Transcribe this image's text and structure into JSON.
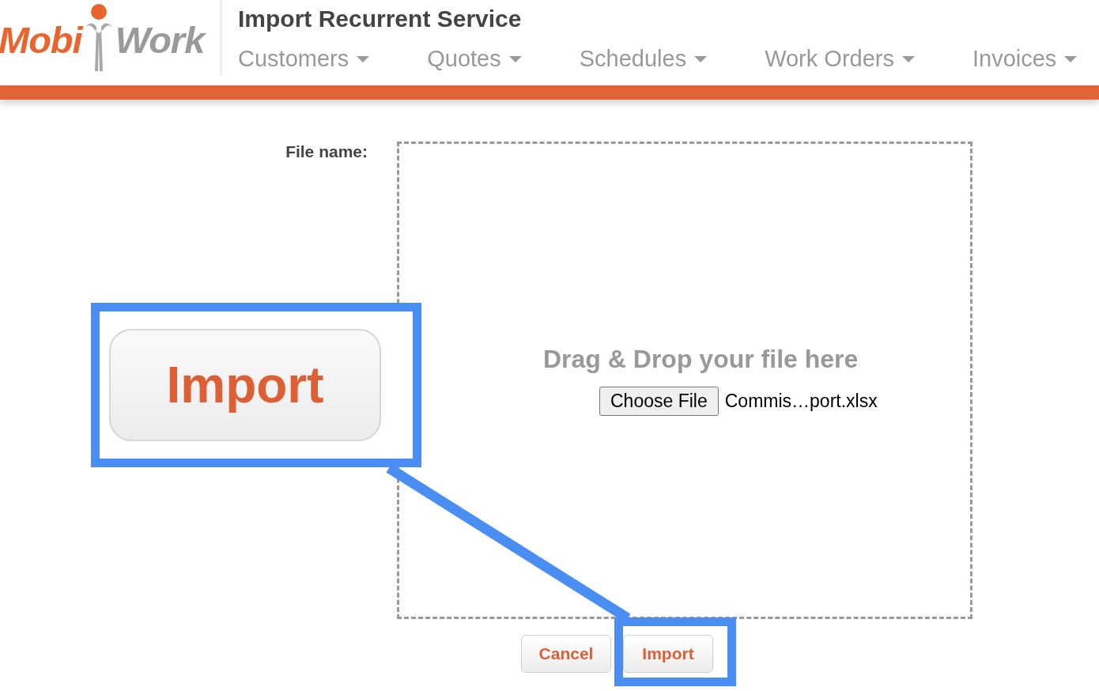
{
  "header": {
    "logo": {
      "left_word": "Mobi",
      "right_word": "Work"
    },
    "title": "Import Recurrent Service",
    "nav": [
      {
        "label": "Customers"
      },
      {
        "label": "Quotes"
      },
      {
        "label": "Schedules"
      },
      {
        "label": "Work Orders"
      },
      {
        "label": "Invoices"
      }
    ]
  },
  "form": {
    "label": "File name:",
    "dropzone": {
      "prompt": "Drag & Drop your file here",
      "choose_button": "Choose File",
      "file_name": "Commis…port.xlsx"
    }
  },
  "buttons": [
    {
      "label": "Cancel"
    },
    {
      "label": "Import"
    }
  ],
  "callout": {
    "magnified_label": "Import"
  }
}
